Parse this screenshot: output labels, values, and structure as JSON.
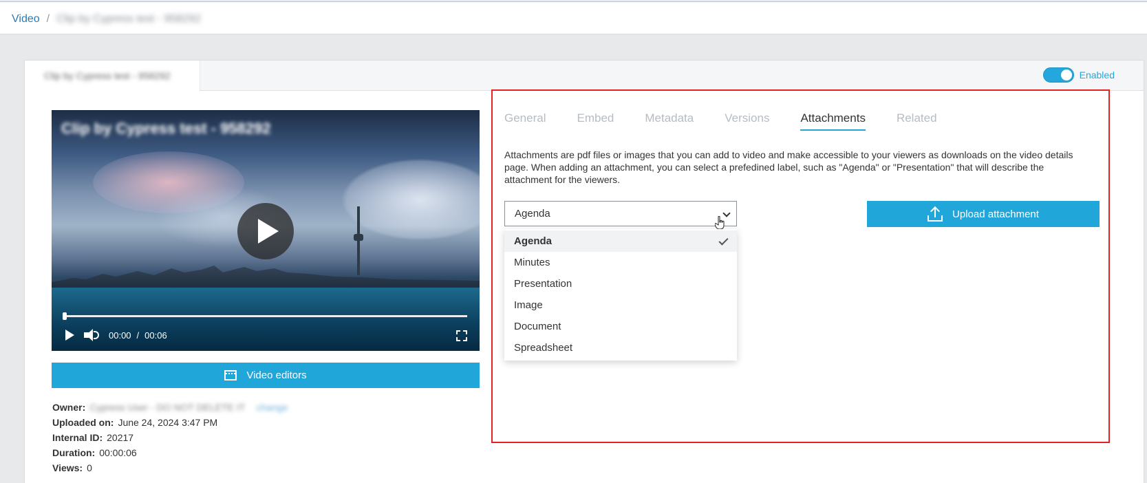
{
  "breadcrumb": {
    "root": "Video",
    "separator": "/",
    "current": "Clip by Cypress test - 958292"
  },
  "card": {
    "title": "Clip by Cypress test - 958292",
    "toggle": {
      "label": "Enabled",
      "state": "on"
    }
  },
  "player": {
    "title": "Clip by Cypress test - 958292",
    "current_time": "00:00",
    "time_separator": "/",
    "duration": "00:06",
    "progress_fraction": 0.0
  },
  "video_editors_label": "Video editors",
  "meta": {
    "owner_label": "Owner:",
    "owner_value": "Cypress User - DO NOT DELETE IT",
    "owner_change": "change",
    "uploaded_label": "Uploaded on:",
    "uploaded_value": "June 24, 2024 3:47 PM",
    "internal_id_label": "Internal ID:",
    "internal_id_value": "20217",
    "duration_label": "Duration:",
    "duration_value": "00:00:06",
    "views_label": "Views:",
    "views_value": "0"
  },
  "tabs": [
    {
      "label": "General",
      "active": false
    },
    {
      "label": "Embed",
      "active": false
    },
    {
      "label": "Metadata",
      "active": false
    },
    {
      "label": "Versions",
      "active": false
    },
    {
      "label": "Attachments",
      "active": true
    },
    {
      "label": "Related",
      "active": false
    }
  ],
  "attachments": {
    "description": "Attachments are pdf files or images that you can add to video and make accessible to your viewers as downloads on the video details page. When adding an attachment, you can select a prefedined label, such as \"Agenda\" or \"Presentation\" that will describe the attachment for the viewers.",
    "select_value": "Agenda",
    "options": [
      "Agenda",
      "Minutes",
      "Presentation",
      "Image",
      "Document",
      "Spreadsheet"
    ],
    "selected_index": 0,
    "upload_label": "Upload attachment"
  },
  "colors": {
    "accent": "#21a6da",
    "highlight_border": "#e02424"
  }
}
